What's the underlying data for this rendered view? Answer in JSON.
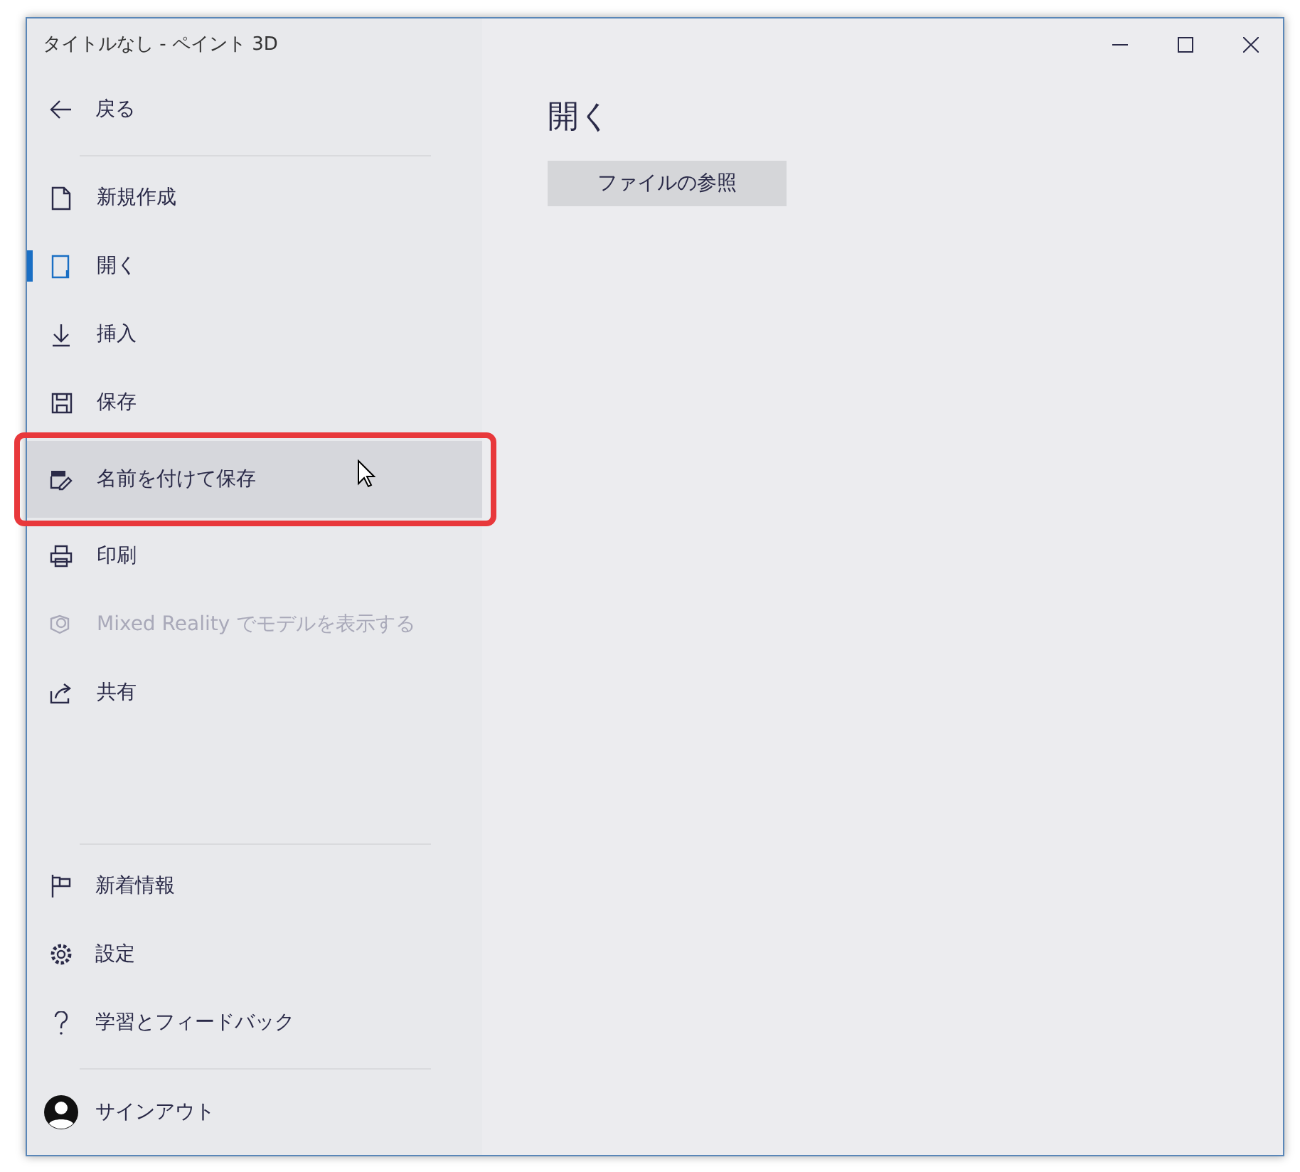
{
  "window": {
    "title": "タイトルなし - ペイント 3D"
  },
  "back": {
    "label": "戻る"
  },
  "menu": [
    {
      "label": "新規作成",
      "selected": false,
      "disabled": false,
      "hovered": false
    },
    {
      "label": "開く",
      "selected": true,
      "disabled": false,
      "hovered": false
    },
    {
      "label": "挿入",
      "selected": false,
      "disabled": false,
      "hovered": false
    },
    {
      "label": "保存",
      "selected": false,
      "disabled": false,
      "hovered": false
    },
    {
      "label": "名前を付けて保存",
      "selected": false,
      "disabled": false,
      "hovered": true
    },
    {
      "label": "印刷",
      "selected": false,
      "disabled": false,
      "hovered": false
    },
    {
      "label": "Mixed Reality でモデルを表示する",
      "selected": false,
      "disabled": true,
      "hovered": false
    },
    {
      "label": "共有",
      "selected": false,
      "disabled": false,
      "hovered": false
    }
  ],
  "footer_menu": [
    {
      "label": "新着情報"
    },
    {
      "label": "設定"
    },
    {
      "label": "学習とフィードバック"
    }
  ],
  "account": {
    "label": "サインアウト"
  },
  "content": {
    "heading": "開く",
    "button": "ファイルの参照"
  }
}
